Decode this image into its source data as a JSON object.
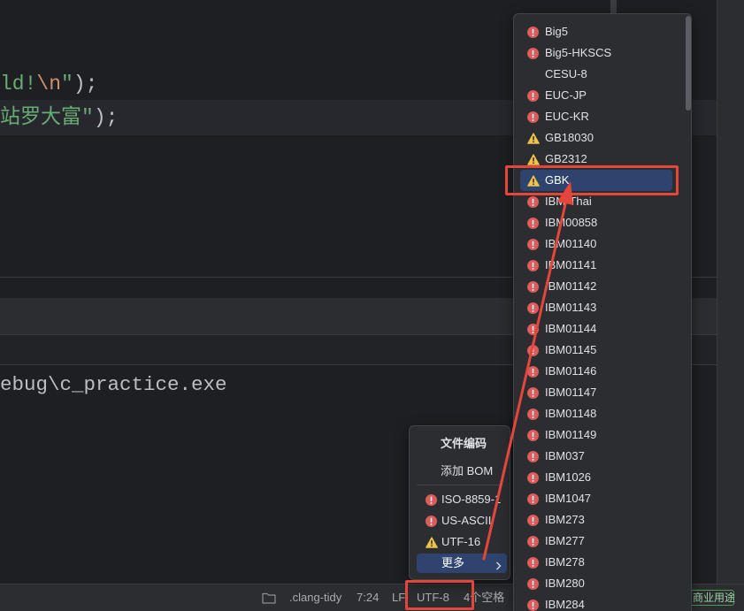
{
  "editor": {
    "line1": {
      "text": "ld!",
      "escape": "\\n",
      "quote": "\"",
      "paren": ")",
      "semicolon": ";"
    },
    "line2": {
      "text": "站罗大富\"",
      "paren": ")",
      "semicolon": ";"
    }
  },
  "terminal": {
    "output": "ebug\\c_practice.exe"
  },
  "status_bar": {
    "file_icon": "folder-icon",
    "file": ".clang-tidy",
    "caret_position": "7:24",
    "line_separator": "LF",
    "encoding": "UTF-8",
    "indent": "4个空格",
    "license": "商业用途"
  },
  "encoding_menu": {
    "title": "文件编码",
    "add_bom": "添加 BOM",
    "items": [
      {
        "label": "ISO-8859-1",
        "icon": "error-icon"
      },
      {
        "label": "US-ASCII",
        "icon": "error-icon"
      },
      {
        "label": "UTF-16",
        "icon": "warning-icon"
      }
    ],
    "more": "更多",
    "more_icon": "chevron-right-icon"
  },
  "encoding_submenu": {
    "items": [
      {
        "label": "Big5",
        "icon": "error-icon"
      },
      {
        "label": "Big5-HKSCS",
        "icon": "error-icon"
      },
      {
        "label": "CESU-8"
      },
      {
        "label": "EUC-JP",
        "icon": "error-icon"
      },
      {
        "label": "EUC-KR",
        "icon": "error-icon"
      },
      {
        "label": "GB18030",
        "icon": "warning-icon"
      },
      {
        "label": "GB2312",
        "icon": "warning-icon"
      },
      {
        "label": "GBK",
        "icon": "warning-icon",
        "selected": true
      },
      {
        "label": "IBM-Thai",
        "icon": "error-icon"
      },
      {
        "label": "IBM00858",
        "icon": "error-icon"
      },
      {
        "label": "IBM01140",
        "icon": "error-icon"
      },
      {
        "label": "IBM01141",
        "icon": "error-icon"
      },
      {
        "label": "IBM01142",
        "icon": "error-icon"
      },
      {
        "label": "IBM01143",
        "icon": "error-icon"
      },
      {
        "label": "IBM01144",
        "icon": "error-icon"
      },
      {
        "label": "IBM01145",
        "icon": "error-icon"
      },
      {
        "label": "IBM01146",
        "icon": "error-icon"
      },
      {
        "label": "IBM01147",
        "icon": "error-icon"
      },
      {
        "label": "IBM01148",
        "icon": "error-icon"
      },
      {
        "label": "IBM01149",
        "icon": "error-icon"
      },
      {
        "label": "IBM037",
        "icon": "error-icon"
      },
      {
        "label": "IBM1026",
        "icon": "error-icon"
      },
      {
        "label": "IBM1047",
        "icon": "error-icon"
      },
      {
        "label": "IBM273",
        "icon": "error-icon"
      },
      {
        "label": "IBM277",
        "icon": "error-icon"
      },
      {
        "label": "IBM278",
        "icon": "error-icon"
      },
      {
        "label": "IBM280",
        "icon": "error-icon"
      },
      {
        "label": "IBM284",
        "icon": "error-icon"
      }
    ]
  },
  "colors": {
    "error": "#db5c5c",
    "warning": "#f0c14b",
    "selection": "#2e436e",
    "annotation": "#e5463c",
    "string": "#6aab73",
    "escape": "#cf8e6d",
    "license": "#4f9a57"
  }
}
